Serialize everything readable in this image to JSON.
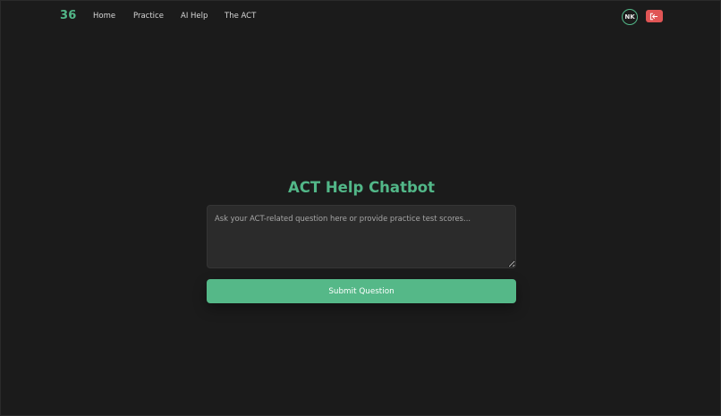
{
  "navbar": {
    "logo": "36",
    "links": [
      "Home",
      "Practice",
      "AI Help",
      "The ACT"
    ],
    "avatar_initials": "NK",
    "logout_icon": "logout-icon"
  },
  "main": {
    "title": "ACT Help Chatbot",
    "input_placeholder": "Ask your ACT-related question here or provide practice test scores...",
    "input_value": "",
    "submit_label": "Submit Question"
  },
  "colors": {
    "background": "#1b1b1b",
    "accent": "#52b788",
    "logout": "#e05555",
    "input_bg": "#2b2b2b"
  }
}
